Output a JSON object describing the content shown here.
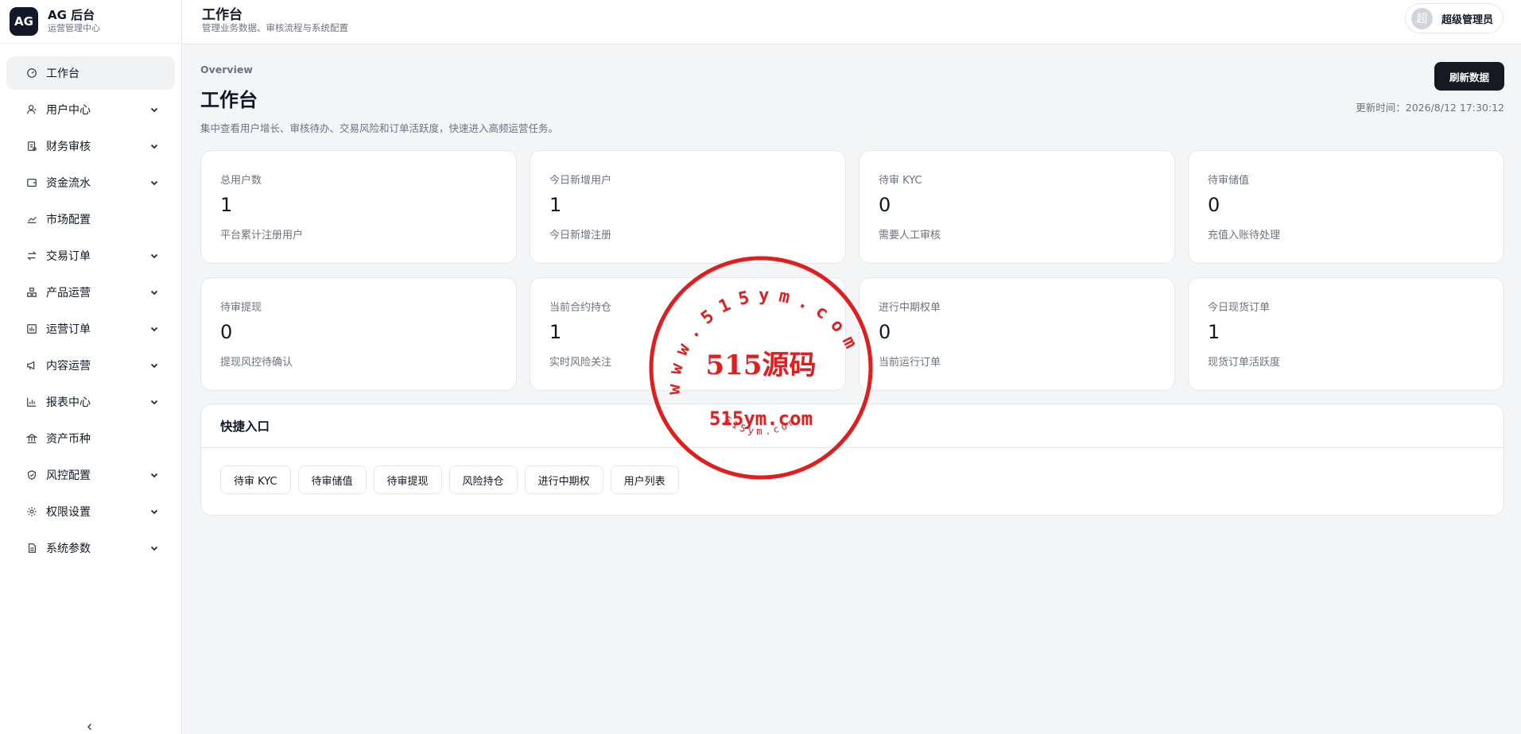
{
  "brand": {
    "logo": "AG",
    "title": "AG 后台",
    "subtitle": "运营管理中心"
  },
  "sidebar": {
    "items": [
      {
        "label": "工作台",
        "icon": "dashboard-icon",
        "active": true,
        "expandable": false
      },
      {
        "label": "用户中心",
        "icon": "users-icon",
        "expandable": true
      },
      {
        "label": "财务审核",
        "icon": "receipt-icon",
        "expandable": true
      },
      {
        "label": "资金流水",
        "icon": "wallet-icon",
        "expandable": true
      },
      {
        "label": "市场配置",
        "icon": "line-chart-icon",
        "expandable": false
      },
      {
        "label": "交易订单",
        "icon": "swap-icon",
        "expandable": true
      },
      {
        "label": "产品运营",
        "icon": "boxes-icon",
        "expandable": true
      },
      {
        "label": "运营订单",
        "icon": "calendar-chart-icon",
        "expandable": true
      },
      {
        "label": "内容运营",
        "icon": "megaphone-icon",
        "expandable": true
      },
      {
        "label": "报表中心",
        "icon": "bar-chart-icon",
        "expandable": true
      },
      {
        "label": "资产币种",
        "icon": "bank-icon",
        "expandable": false
      },
      {
        "label": "风控配置",
        "icon": "shield-icon",
        "expandable": true
      },
      {
        "label": "权限设置",
        "icon": "gear-icon",
        "expandable": true
      },
      {
        "label": "系统参数",
        "icon": "document-icon",
        "expandable": true
      }
    ]
  },
  "header": {
    "title": "工作台",
    "subtitle": "管理业务数据、审核流程与系统配置",
    "user_avatar": "超",
    "user_name": "超级管理员"
  },
  "main": {
    "overview": "Overview",
    "title": "工作台",
    "description": "集中查看用户增长、审核待办、交易风险和订单活跃度，快速进入高频运营任务。",
    "refresh_label": "刷新数据",
    "updated": "更新时间：2026/8/12 17:30:12",
    "cards": [
      {
        "label": "总用户数",
        "value": "1",
        "note": "平台累计注册用户"
      },
      {
        "label": "今日新增用户",
        "value": "1",
        "note": "今日新增注册"
      },
      {
        "label": "待审 KYC",
        "value": "0",
        "note": "需要人工审核"
      },
      {
        "label": "待审储值",
        "value": "0",
        "note": "充值入账待处理"
      },
      {
        "label": "待审提现",
        "value": "0",
        "note": "提现风控待确认"
      },
      {
        "label": "当前合约持仓",
        "value": "1",
        "note": "实时风险关注"
      },
      {
        "label": "进行中期权单",
        "value": "0",
        "note": "当前运行订单"
      },
      {
        "label": "今日现货订单",
        "value": "1",
        "note": "现货订单活跃度"
      }
    ],
    "quick": {
      "title": "快捷入口",
      "buttons": [
        "待审 KYC",
        "待审储值",
        "待审提现",
        "风险持仓",
        "进行中期权",
        "用户列表"
      ]
    }
  },
  "watermark": {
    "ring_text": "www.515ym.com",
    "center_text": "515源码",
    "domain_text": "515ym.com",
    "bottom_text": "515ym.com",
    "color": "#e11d1d"
  }
}
